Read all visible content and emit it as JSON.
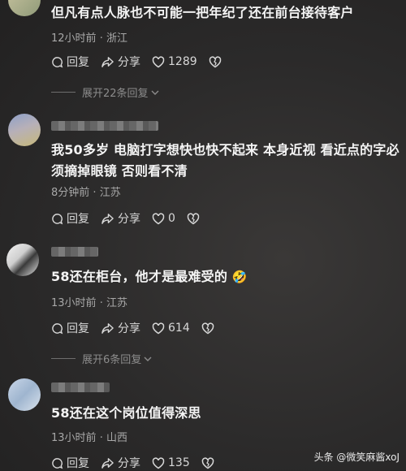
{
  "comments": [
    {
      "text": "但凡有点人脉也不可能一把年纪了还在前台接待客户",
      "time": "12小时前",
      "location": "浙江",
      "reply_label": "回复",
      "share_label": "分享",
      "likes": "1289"
    },
    {
      "text_line1": "我50多岁 电脑打字想快也快不起来 本身近视 看近点的字必",
      "text_line2": "须摘掉眼镜 否则看不清",
      "time": "8分钟前",
      "location": "江苏",
      "reply_label": "回复",
      "share_label": "分享",
      "likes": "0"
    },
    {
      "text": "58还在柜台，他才是最难受的",
      "emoji": "🤣",
      "time": "13小时前",
      "location": "江苏",
      "reply_label": "回复",
      "share_label": "分享",
      "likes": "614"
    },
    {
      "text": "58还在这个岗位值得深思",
      "time": "13小时前",
      "location": "山西",
      "reply_label": "回复",
      "share_label": "分享",
      "likes": "135"
    }
  ],
  "expand_replies": [
    {
      "label": "展开22条回复"
    },
    {
      "label": "展开6条回复"
    }
  ],
  "separator": "·",
  "watermark": "头条 @微笑麻酱xoJ",
  "colors": {
    "background": "#2b2a2a",
    "text": "#f4f4f4",
    "meta": "#a8a8a8"
  }
}
